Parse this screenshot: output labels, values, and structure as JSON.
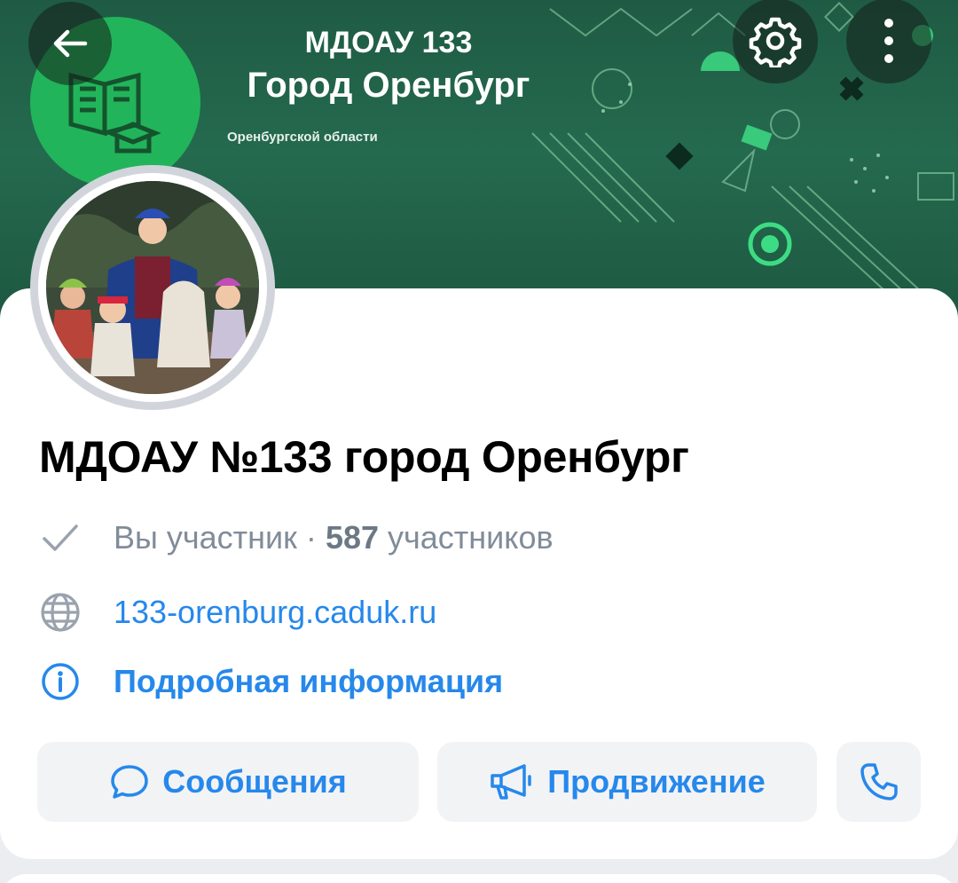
{
  "cover": {
    "title_line1": "МДОАУ 133",
    "title_line2": "Город Оренбург",
    "subtitle": "Оренбургской области"
  },
  "header": {
    "back_icon": "arrow-left-icon",
    "settings_icon": "gear-icon",
    "more_icon": "more-vertical-icon"
  },
  "group": {
    "name": "МДОАУ №133 город Оренбург",
    "membership_status": "Вы участник",
    "separator": "·",
    "members_count": "587",
    "members_label": "участников",
    "website": "133-orenburg.caduk.ru",
    "details_link": "Подробная информация"
  },
  "actions": {
    "messages_label": "Сообщения",
    "promotion_label": "Продвижение"
  },
  "colors": {
    "accent": "#2688eb",
    "secondary_text": "#818c99",
    "cover_green": "#246a4e",
    "logo_green": "#22b45a"
  }
}
